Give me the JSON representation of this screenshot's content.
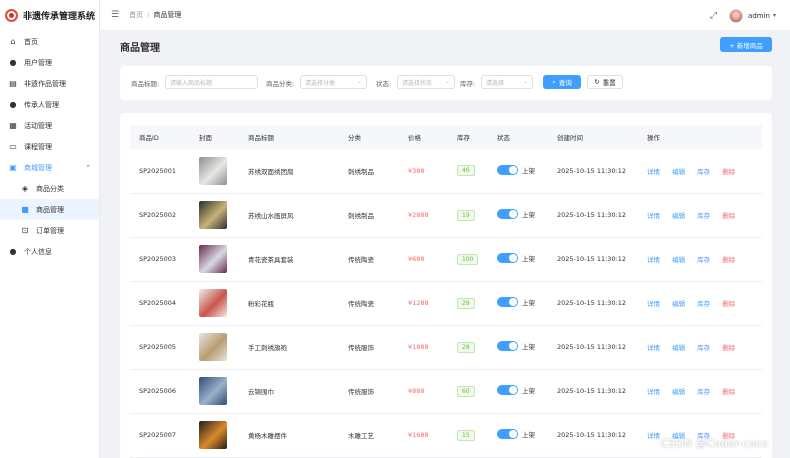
{
  "app": {
    "title": "非遗传承管理系统"
  },
  "sidebar": {
    "items": [
      {
        "label": "首页",
        "icon": "home-icon",
        "glyph": "⌂"
      },
      {
        "label": "用户管理",
        "icon": "user-icon",
        "glyph": "👤"
      },
      {
        "label": "非遗作品管理",
        "icon": "collection-icon",
        "glyph": "▤"
      },
      {
        "label": "传承人管理",
        "icon": "person-icon",
        "glyph": "👤"
      },
      {
        "label": "活动管理",
        "icon": "calendar-icon",
        "glyph": "▦"
      },
      {
        "label": "课程管理",
        "icon": "book-icon",
        "glyph": "▭"
      },
      {
        "label": "商城管理",
        "icon": "shop-icon",
        "glyph": "▣"
      },
      {
        "label": "商品分类",
        "icon": "tag-icon",
        "glyph": "◈"
      },
      {
        "label": "商品管理",
        "icon": "goods-icon",
        "glyph": "▪"
      },
      {
        "label": "订单管理",
        "icon": "cart-icon",
        "glyph": "🛒"
      },
      {
        "label": "个人信息",
        "icon": "profile-icon",
        "glyph": "👤"
      }
    ]
  },
  "header": {
    "breadcrumb": [
      "首页",
      "商品管理"
    ],
    "username": "admin"
  },
  "page": {
    "title": "商品管理",
    "add_button": "+ 新增商品"
  },
  "filters": {
    "title_label": "商品标题:",
    "title_placeholder": "请输入商品标题",
    "category_label": "商品分类:",
    "category_placeholder": "请选择分类",
    "status_label": "状态:",
    "status_placeholder": "请选择状态",
    "stock_label": "库存:",
    "stock_placeholder": "请选择",
    "query_button": "查询",
    "reset_button": "重置"
  },
  "table": {
    "columns": [
      "商品ID",
      "封面",
      "商品标题",
      "分类",
      "价格",
      "库存",
      "状态",
      "创建时间",
      "操作"
    ],
    "actions": [
      "详情",
      "编辑",
      "库存",
      "删除"
    ],
    "rows": [
      {
        "id": "SP2025001",
        "title": "苏绣双面绣团扇",
        "category": "刺绣制品",
        "price": "¥388",
        "stock": "46",
        "status": "上架",
        "created": "2025-10-15 11:30:12",
        "thumb": [
          "#8a8f93",
          "#e9e7e2"
        ]
      },
      {
        "id": "SP2025002",
        "title": "苏绣山水画屏风",
        "category": "刺绣制品",
        "price": "¥2888",
        "stock": "19",
        "status": "上架",
        "created": "2025-10-15 11:30:12",
        "thumb": [
          "#2b2f2e",
          "#c9b27a"
        ]
      },
      {
        "id": "SP2025003",
        "title": "青花瓷茶具套装",
        "category": "传统陶瓷",
        "price": "¥688",
        "stock": "100",
        "status": "上架",
        "created": "2025-10-15 11:30:12",
        "thumb": [
          "#6a2a4a",
          "#d8d9e4"
        ]
      },
      {
        "id": "SP2025004",
        "title": "粉彩花瓶",
        "category": "传统陶瓷",
        "price": "¥1288",
        "stock": "29",
        "status": "上架",
        "created": "2025-10-15 11:30:12",
        "thumb": [
          "#f1eee9",
          "#c9544c"
        ]
      },
      {
        "id": "SP2025005",
        "title": "手工刺绣旗袍",
        "category": "传统服饰",
        "price": "¥1888",
        "stock": "28",
        "status": "上架",
        "created": "2025-10-15 11:30:12",
        "thumb": [
          "#e9e4dc",
          "#b89c73"
        ]
      },
      {
        "id": "SP2025006",
        "title": "云锦围巾",
        "category": "传统服饰",
        "price": "¥888",
        "stock": "60",
        "status": "上架",
        "created": "2025-10-15 11:30:12",
        "thumb": [
          "#2e4d78",
          "#9bb0c9"
        ]
      },
      {
        "id": "SP2025007",
        "title": "黄杨木雕摆件",
        "category": "木雕工艺",
        "price": "¥1688",
        "stock": "15",
        "status": "上架",
        "created": "2025-10-15 11:30:12",
        "thumb": [
          "#221e1c",
          "#d98b2a"
        ]
      }
    ]
  },
  "watermark": "CSDN @Coder-coco",
  "colors": {
    "primary": "#409eff",
    "danger": "#f56c6c",
    "success": "#67c23a"
  }
}
